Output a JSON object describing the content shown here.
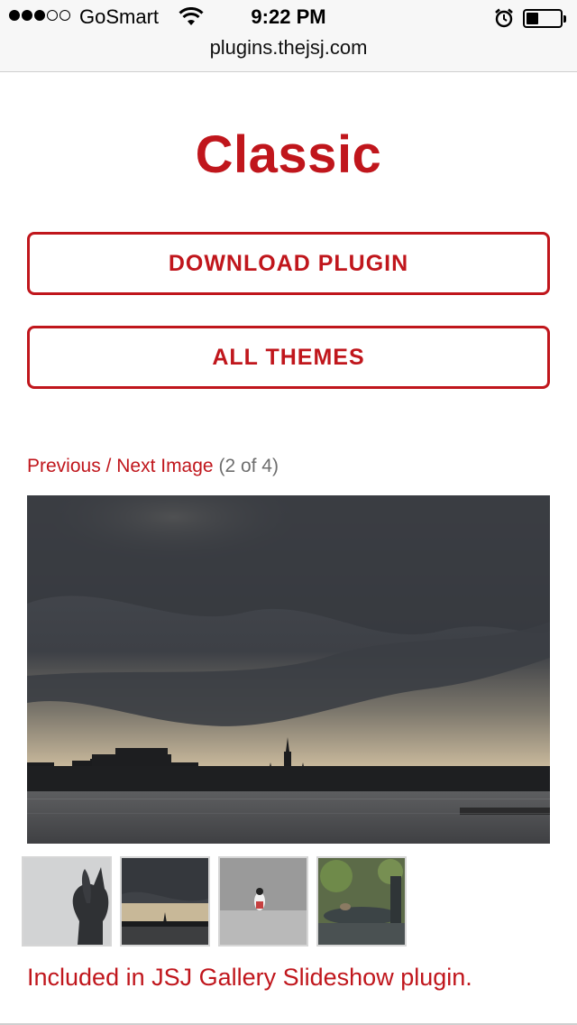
{
  "status_bar": {
    "signal_bars_filled": 3,
    "signal_bars_total": 5,
    "carrier": "GoSmart",
    "time": "9:22 PM",
    "battery_level": 0.35,
    "icons": [
      "signal-dots-icon",
      "wifi-icon",
      "alarm-clock-icon",
      "battery-icon"
    ]
  },
  "browser": {
    "url": "plugins.thejsj.com"
  },
  "page": {
    "title": "Classic",
    "download_button": "DOWNLOAD PLUGIN",
    "themes_button": "ALL THEMES",
    "pager": {
      "previous": "Previous",
      "separator": " / ",
      "next": "Next Image",
      "count": "(2 of 4)"
    },
    "main_image_alt": "",
    "thumbnails": [
      {
        "subject": "statue-silhouette"
      },
      {
        "subject": "storm-cathedral"
      },
      {
        "subject": "bird-on-ledge"
      },
      {
        "subject": "bird-on-fountain"
      }
    ],
    "selected_thumbnail": 2,
    "footer_note": "Included in JSJ Gallery Slideshow plugin."
  },
  "colors": {
    "accent": "#c0161c",
    "count_gray": "#6e6e6e",
    "statusbar_bg": "#f7f7f7"
  }
}
